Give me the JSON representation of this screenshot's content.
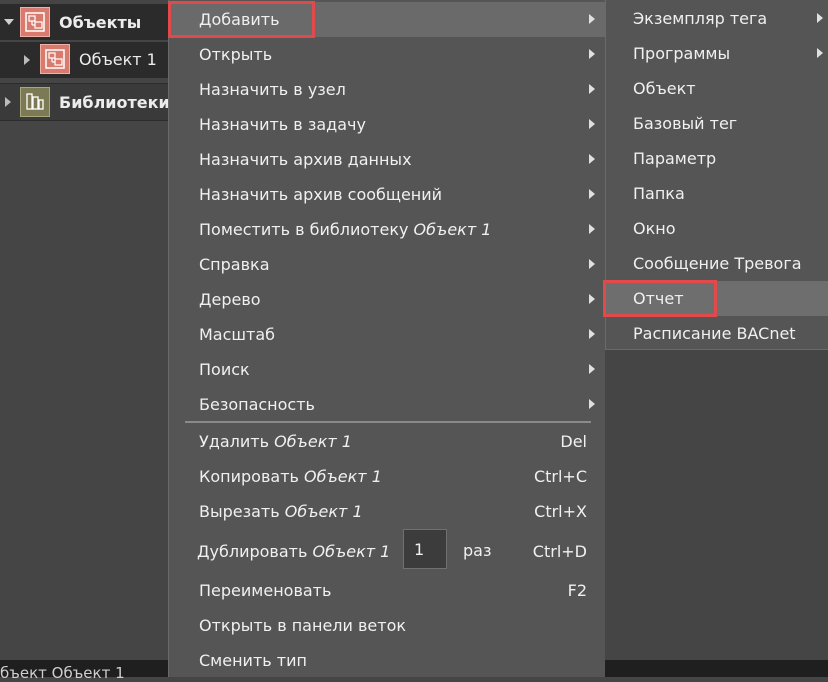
{
  "tree": {
    "objects_label": "Объекты",
    "object1_label": "Объект 1",
    "libraries_label": "Библиотеки"
  },
  "statusbar": {
    "text": "бъект   Объект 1"
  },
  "menu": {
    "items": [
      {
        "label": "Добавить"
      },
      {
        "label": "Открыть"
      },
      {
        "label": "Назначить в узел"
      },
      {
        "label": "Назначить в задачу"
      },
      {
        "label": "Назначить архив данных"
      },
      {
        "label": "Назначить архив сообщений"
      },
      {
        "label": "Поместить в библиотеку",
        "italic": "Объект 1"
      },
      {
        "label": "Справка"
      },
      {
        "label": "Дерево"
      },
      {
        "label": "Масштаб"
      },
      {
        "label": "Поиск"
      },
      {
        "label": "Безопасность"
      }
    ],
    "actions": [
      {
        "label": "Удалить",
        "italic": "Объект 1",
        "shortcut": "Del"
      },
      {
        "label": "Копировать",
        "italic": "Объект 1",
        "shortcut": "Ctrl+C"
      },
      {
        "label": "Вырезать",
        "italic": "Объект 1",
        "shortcut": "Ctrl+X"
      },
      {
        "label": "Дублировать",
        "italic": "Объект 1",
        "shortcut": "Ctrl+D",
        "count": "1",
        "unit": "раз"
      },
      {
        "label": "Переименовать",
        "shortcut": "F2"
      },
      {
        "label": "Открыть в панели веток"
      },
      {
        "label": "Сменить тип"
      }
    ]
  },
  "submenu": {
    "items": [
      {
        "label": "Экземпляр тега"
      },
      {
        "label": "Программы"
      },
      {
        "label": "Объект"
      },
      {
        "label": "Базовый тег"
      },
      {
        "label": "Параметр"
      },
      {
        "label": "Папка"
      },
      {
        "label": "Окно"
      },
      {
        "label": "Сообщение Тревога"
      },
      {
        "label": "Отчет"
      },
      {
        "label": "Расписание BACnet"
      }
    ]
  },
  "colors": {
    "menu_bg": "#555555",
    "highlight": "#6a6a6a",
    "annotation_red": "#e04a4a",
    "object_icon": "#d97a6e",
    "library_icon": "#7c7a55"
  }
}
